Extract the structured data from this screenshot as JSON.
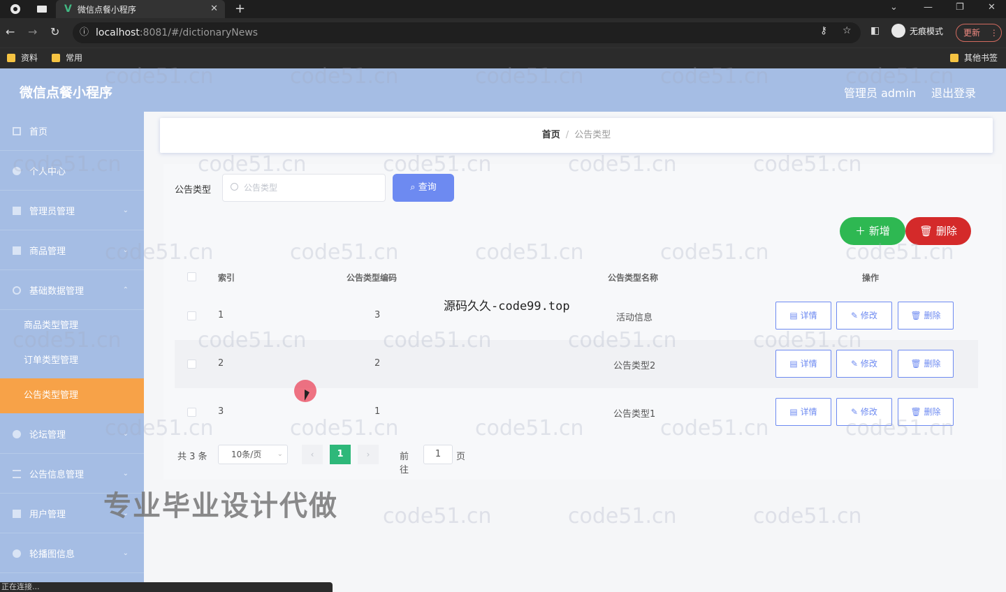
{
  "browser": {
    "tab_title": "微信点餐小程序",
    "tab_close": "✕",
    "new_tab": "+",
    "url_host": "localhost",
    "url_path": ":8081/#/dictionaryNews",
    "incognito": "无痕模式",
    "update": "更新",
    "bookmarks": [
      "资料",
      "常用"
    ],
    "other_bookmarks": "其他书签"
  },
  "header": {
    "title": "微信点餐小程序",
    "user": "管理员 admin",
    "logout": "退出登录"
  },
  "sidebar": {
    "items": [
      {
        "label": "首页"
      },
      {
        "label": "个人中心"
      },
      {
        "label": "管理员管理"
      },
      {
        "label": "商品管理"
      },
      {
        "label": "基础数据管理"
      }
    ],
    "sub_items": [
      {
        "label": "商品类型管理"
      },
      {
        "label": "订单类型管理"
      },
      {
        "label": "公告类型管理"
      }
    ],
    "items_after": [
      {
        "label": "论坛管理"
      },
      {
        "label": "公告信息管理"
      },
      {
        "label": "用户管理"
      },
      {
        "label": "轮播图信息"
      }
    ]
  },
  "breadcrumb": {
    "home": "首页",
    "separator": "/",
    "current": "公告类型"
  },
  "search": {
    "label": "公告类型",
    "placeholder": "公告类型",
    "button": "查询"
  },
  "actions": {
    "add": "新增",
    "delete": "删除"
  },
  "table": {
    "headers": [
      "索引",
      "公告类型编码",
      "公告类型名称",
      "操作"
    ],
    "rows": [
      {
        "index": "1",
        "code": "3",
        "name": "活动信息"
      },
      {
        "index": "2",
        "code": "2",
        "name": "公告类型2"
      },
      {
        "index": "3",
        "code": "1",
        "name": "公告类型1"
      }
    ],
    "row_actions": {
      "detail": "详情",
      "edit": "修改",
      "delete": "删除"
    }
  },
  "pagination": {
    "total": "共 3 条",
    "page_size": "10条/页",
    "current_page": "1",
    "goto_label": "前往",
    "goto_value": "1",
    "page_suffix": "页"
  },
  "overlay": {
    "source_text": "源码久久-code99.top",
    "promo_text": "专业毕业设计代做",
    "status": "正在连接..."
  },
  "watermark": "code51.cn",
  "colors": {
    "header": "#a5bde4",
    "active_menu": "#f7a248",
    "primary": "#6d8af1",
    "success": "#2eb852",
    "danger": "#d42a2a"
  }
}
